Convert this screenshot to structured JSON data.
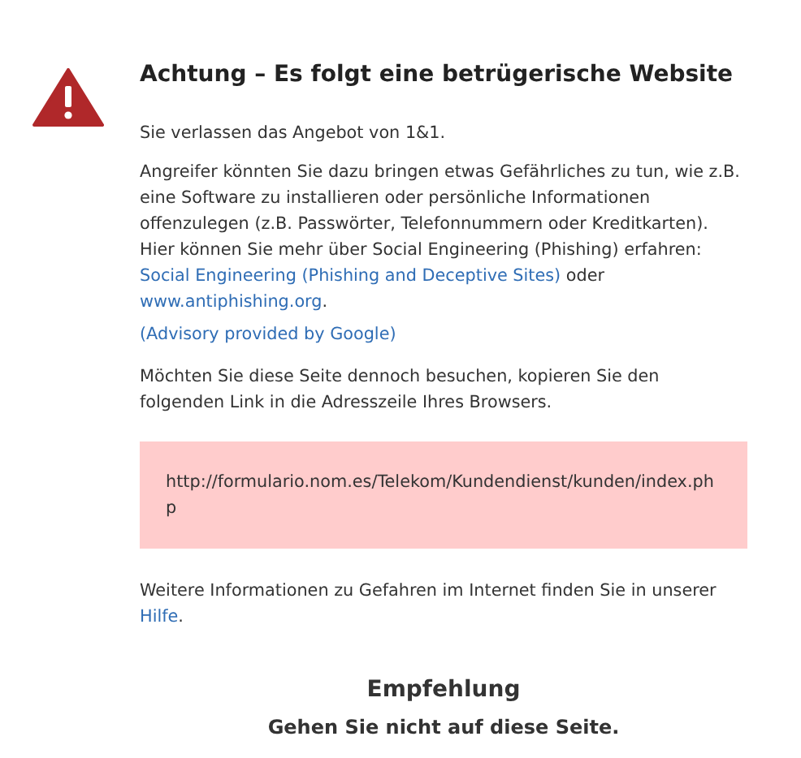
{
  "title": "Achtung – Es folgt eine betrügerische Website",
  "intro": "Sie verlassen das Angebot von 1&1.",
  "explanation": [
    {
      "text": "Angreifer könnten Sie dazu bringen etwas Gefährliches zu tun, wie z.B. eine Software zu installieren oder persönliche Informationen offenzulegen (z.B. Passwörter, Telefonnummern oder Kreditkarten). Hier können Sie mehr über Social Engineering (Phishing) erfahren: ",
      "link": false
    },
    {
      "text": "Social Engineering (Phishing and Deceptive Sites)",
      "link": true
    },
    {
      "text": " oder ",
      "link": false
    },
    {
      "text": "www.antiphishing.org",
      "link": true
    },
    {
      "text": ".",
      "link": false
    }
  ],
  "advisory_link": "(Advisory provided by Google)",
  "instruction": "Möchten Sie diese Seite dennoch besuchen, kopieren Sie den folgenden Link in die Adresszeile Ihres Browsers.",
  "url": "http://formulario.nom.es/Telekom/Kundendienst/kunden/index.php",
  "more_info": [
    {
      "text": "Weitere Informationen zu Gefahren im Internet finden Sie in unserer ",
      "link": false
    },
    {
      "text": "Hilfe",
      "link": true
    },
    {
      "text": ".",
      "link": false
    }
  ],
  "recommendation_heading": "Empfehlung",
  "recommendation": "Gehen Sie nicht auf diese Seite."
}
